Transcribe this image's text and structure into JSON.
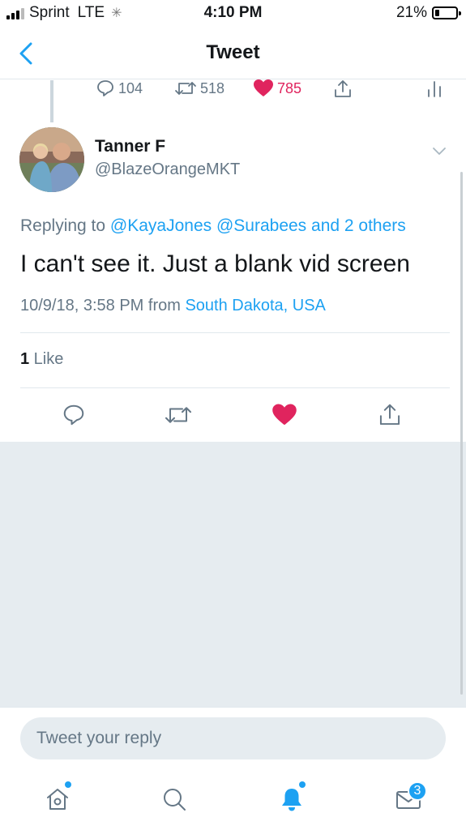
{
  "status_bar": {
    "carrier": "Sprint",
    "network": "LTE",
    "time": "4:10 PM",
    "battery": "21%",
    "battery_level": 0.21
  },
  "navbar": {
    "title": "Tweet",
    "back_icon": "chevron-left-icon"
  },
  "parent_tweet_actions": {
    "replies": "104",
    "retweets": "518",
    "likes": "785"
  },
  "tweet": {
    "author_name": "Tanner F",
    "author_handle": "@BlazeOrangeMKT",
    "replying_prefix": "Replying to ",
    "replying_to": "@KayaJones @Surabees and 2 others",
    "text": "I can't see it. Just a blank vid screen",
    "timestamp": "10/9/18, 3:58 PM",
    "from_label": " from ",
    "location": "South Dakota, USA",
    "like_count": "1",
    "like_label": " Like"
  },
  "reply": {
    "placeholder": "Tweet your reply"
  },
  "tabbar": {
    "notifications_badge": "3"
  },
  "colors": {
    "accent": "#1da1f2",
    "like": "#e0245e",
    "secondary_text": "#657786",
    "background_gray": "#e6ecf0"
  }
}
